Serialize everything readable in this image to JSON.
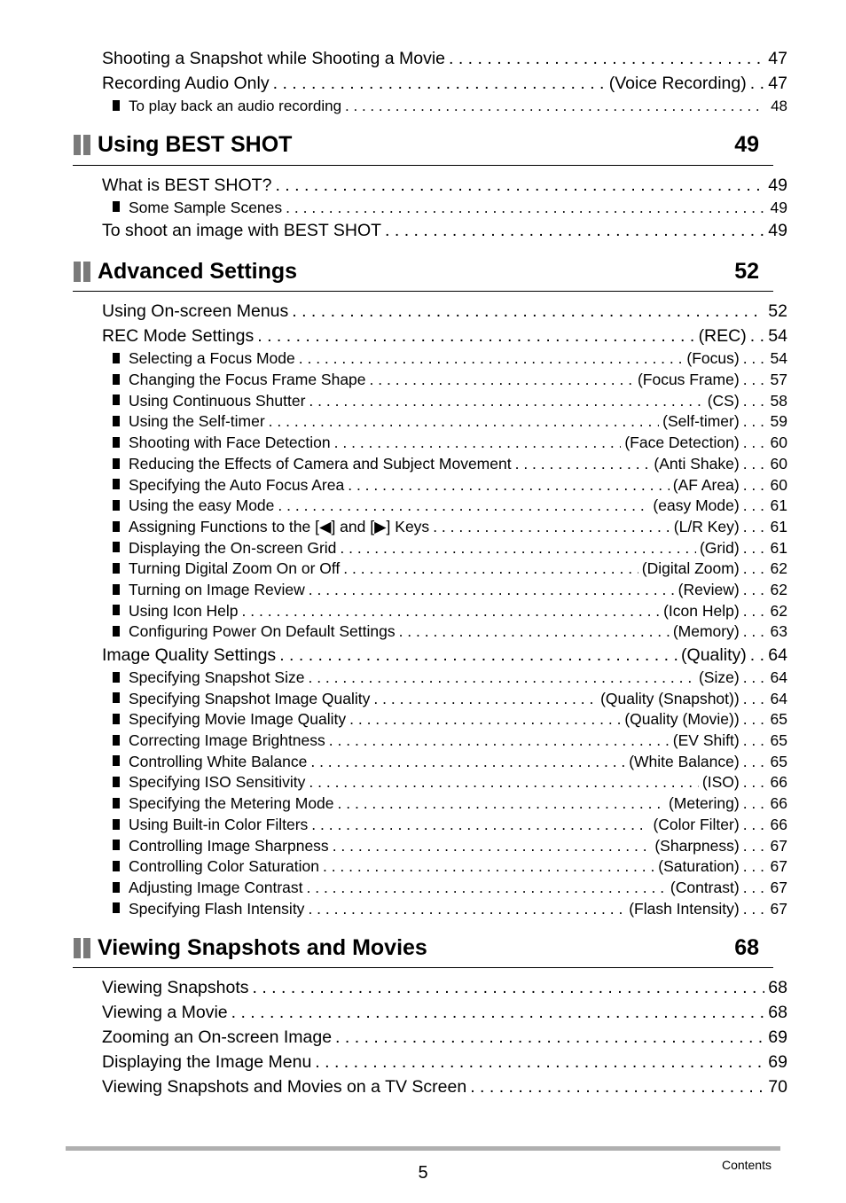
{
  "intro_entries": [
    {
      "level": "main",
      "title": "Shooting a Snapshot while Shooting a Movie",
      "tag": "",
      "page": "47"
    },
    {
      "level": "main",
      "title": "Recording Audio Only",
      "tag": "(Voice Recording)",
      "page": "47"
    },
    {
      "level": "sub",
      "title": "To play back an audio recording",
      "tag": "",
      "page": "48"
    }
  ],
  "sections": [
    {
      "title": "Using BEST SHOT",
      "page": "49",
      "entries": [
        {
          "level": "main",
          "title": "What is BEST SHOT?",
          "tag": "",
          "page": "49"
        },
        {
          "level": "sub",
          "title": "Some Sample Scenes",
          "tag": "",
          "page": "49"
        },
        {
          "level": "main",
          "title": "To shoot an image with BEST SHOT",
          "tag": "",
          "page": "49"
        }
      ]
    },
    {
      "title": "Advanced Settings",
      "page": "52",
      "entries": [
        {
          "level": "main",
          "title": "Using On-screen Menus",
          "tag": "",
          "page": "52"
        },
        {
          "level": "main",
          "title": "REC Mode Settings",
          "tag": "(REC)",
          "page": "54"
        },
        {
          "level": "sub",
          "title": "Selecting a Focus Mode",
          "tag": "(Focus)",
          "page": "54"
        },
        {
          "level": "sub",
          "title": "Changing the Focus Frame Shape",
          "tag": "(Focus Frame)",
          "page": "57"
        },
        {
          "level": "sub",
          "title": "Using Continuous Shutter",
          "tag": "(CS)",
          "page": "58"
        },
        {
          "level": "sub",
          "title": "Using the Self-timer",
          "tag": "(Self-timer)",
          "page": "59"
        },
        {
          "level": "sub",
          "title": "Shooting with Face Detection",
          "tag": "(Face Detection)",
          "page": "60"
        },
        {
          "level": "sub",
          "title": "Reducing the Effects of Camera and Subject Movement",
          "tag": "(Anti Shake)",
          "page": "60"
        },
        {
          "level": "sub",
          "title": "Specifying the Auto Focus Area",
          "tag": "(AF Area)",
          "page": "60"
        },
        {
          "level": "sub",
          "title": "Using the easy Mode",
          "tag": "(easy Mode)",
          "page": "61"
        },
        {
          "level": "sub",
          "title": "Assigning Functions to the [◀] and [▶] Keys",
          "tag": "(L/R Key)",
          "page": "61"
        },
        {
          "level": "sub",
          "title": "Displaying the On-screen Grid",
          "tag": "(Grid)",
          "page": "61"
        },
        {
          "level": "sub",
          "title": "Turning Digital Zoom On or Off",
          "tag": "(Digital Zoom)",
          "page": "62"
        },
        {
          "level": "sub",
          "title": "Turning on Image Review",
          "tag": "(Review)",
          "page": "62"
        },
        {
          "level": "sub",
          "title": "Using Icon Help",
          "tag": "(Icon Help)",
          "page": "62"
        },
        {
          "level": "sub",
          "title": "Configuring Power On Default Settings",
          "tag": "(Memory)",
          "page": "63"
        },
        {
          "level": "main",
          "title": "Image Quality Settings",
          "tag": "(Quality)",
          "page": "64"
        },
        {
          "level": "sub",
          "title": "Specifying Snapshot Size",
          "tag": "(Size)",
          "page": "64"
        },
        {
          "level": "sub",
          "title": "Specifying Snapshot Image Quality",
          "tag": "(Quality (Snapshot))",
          "page": "64"
        },
        {
          "level": "sub",
          "title": "Specifying Movie Image Quality",
          "tag": "(Quality (Movie))",
          "page": "65"
        },
        {
          "level": "sub",
          "title": "Correcting Image Brightness",
          "tag": "(EV Shift)",
          "page": "65"
        },
        {
          "level": "sub",
          "title": "Controlling White Balance",
          "tag": "(White Balance)",
          "page": "65"
        },
        {
          "level": "sub",
          "title": "Specifying ISO Sensitivity",
          "tag": "(ISO)",
          "page": "66"
        },
        {
          "level": "sub",
          "title": "Specifying the Metering Mode",
          "tag": "(Metering)",
          "page": "66"
        },
        {
          "level": "sub",
          "title": "Using Built-in Color Filters",
          "tag": "(Color Filter)",
          "page": "66"
        },
        {
          "level": "sub",
          "title": "Controlling Image Sharpness",
          "tag": "(Sharpness)",
          "page": "67"
        },
        {
          "level": "sub",
          "title": "Controlling Color Saturation",
          "tag": "(Saturation)",
          "page": "67"
        },
        {
          "level": "sub",
          "title": "Adjusting Image Contrast",
          "tag": "(Contrast)",
          "page": "67"
        },
        {
          "level": "sub",
          "title": "Specifying Flash Intensity",
          "tag": "(Flash Intensity)",
          "page": "67"
        }
      ]
    },
    {
      "title": "Viewing Snapshots and Movies",
      "page": "68",
      "entries": [
        {
          "level": "main",
          "title": "Viewing Snapshots",
          "tag": "",
          "page": "68"
        },
        {
          "level": "main",
          "title": "Viewing a Movie",
          "tag": "",
          "page": "68"
        },
        {
          "level": "main",
          "title": "Zooming an On-screen Image",
          "tag": "",
          "page": "69"
        },
        {
          "level": "main",
          "title": "Displaying the Image Menu",
          "tag": "",
          "page": "69"
        },
        {
          "level": "main",
          "title": "Viewing Snapshots and Movies on a TV Screen",
          "tag": "",
          "page": "70"
        }
      ]
    }
  ],
  "footer": {
    "page_number": "5",
    "label": "Contents"
  },
  "colors": {
    "section_icon": "#7a7a7a",
    "footer_bar": "#b0b0b0"
  }
}
